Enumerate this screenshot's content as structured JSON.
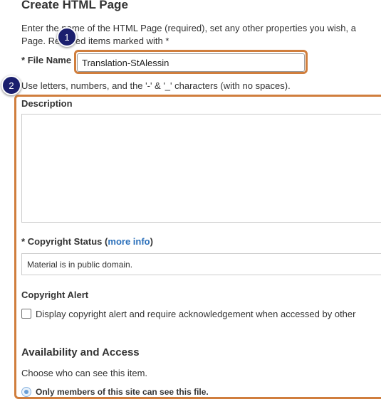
{
  "page": {
    "title": "Create HTML Page",
    "intro_line1": "Enter the name of the HTML Page (required), set any other properties you wish, a",
    "intro_line2": "Page. Required items marked with *"
  },
  "file_name": {
    "required_mark": "*",
    "label": "File Name",
    "value": "Translation-StAlessin",
    "hint": "Use letters, numbers, and the '-' & '_' characters (with no spaces)."
  },
  "callouts": {
    "badge1": "1",
    "badge2": "2",
    "color": "#d07e3d",
    "badge_color": "#1b1f6e"
  },
  "description": {
    "label": "Description",
    "value": ""
  },
  "copyright_status": {
    "required_mark": "*",
    "label": "Copyright Status",
    "open_paren": "(",
    "link": "more info",
    "close_paren": ")",
    "selected": "Material is in public domain."
  },
  "copyright_alert": {
    "label": "Copyright Alert",
    "checkbox_label": "Display copyright alert and require acknowledgement when accessed by other",
    "checked": false
  },
  "availability": {
    "title": "Availability and Access",
    "subtitle": "Choose who can see this item.",
    "option": "Only members of this site can see this file."
  }
}
